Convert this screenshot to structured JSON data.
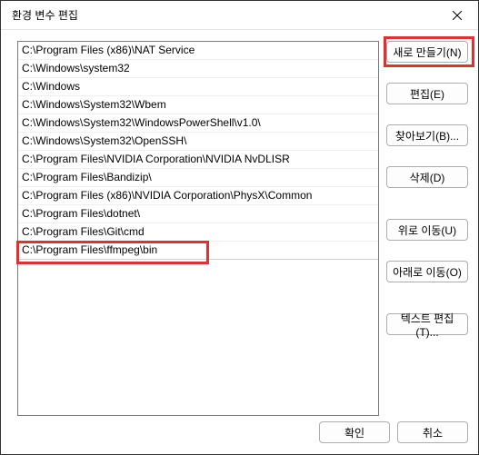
{
  "title": "환경 변수 편집",
  "paths": [
    "C:\\Program Files (x86)\\NAT Service",
    "C:\\Windows\\system32",
    "C:\\Windows",
    "C:\\Windows\\System32\\Wbem",
    "C:\\Windows\\System32\\WindowsPowerShell\\v1.0\\",
    "C:\\Windows\\System32\\OpenSSH\\",
    "C:\\Program Files\\NVIDIA Corporation\\NVIDIA NvDLISR",
    "C:\\Program Files\\Bandizip\\",
    "C:\\Program Files (x86)\\NVIDIA Corporation\\PhysX\\Common",
    "C:\\Program Files\\dotnet\\",
    "C:\\Program Files\\Git\\cmd",
    "C:\\Program Files\\ffmpeg\\bin"
  ],
  "buttons": {
    "new": "새로 만들기(N)",
    "edit": "편집(E)",
    "browse": "찾아보기(B)...",
    "delete": "삭제(D)",
    "moveUp": "위로 이동(U)",
    "moveDown": "아래로 이동(O)",
    "editText": "텍스트 편집(T)...",
    "ok": "확인",
    "cancel": "취소"
  }
}
